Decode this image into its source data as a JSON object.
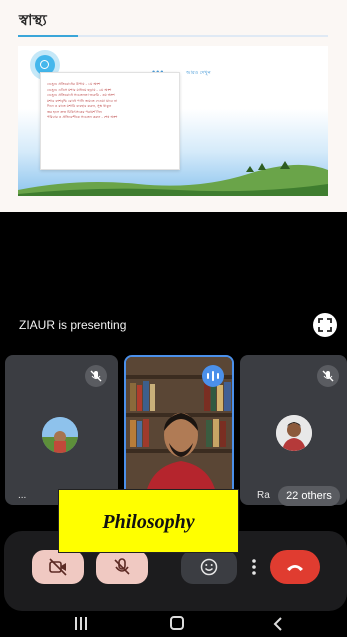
{
  "presentation": {
    "slide_title": "স্বাস্থ্য",
    "note_lines": [
      "ডেঙ্গু প্রতিরোধের উপায় - ১ম অংশ",
      "ডেঙ্গু এডিস মশার মাধ্যমে ছড়ায় - ২য় অংশ",
      "ডেঙ্গু প্রতিরোধে সচেতনতা জরুরি - ৩য় অংশ",
      "মশার বংশবৃদ্ধি রোধে পানি জমতে দেওয়া যাবে না",
      "দিনে ও রাতে মশারি ব্যবহার করুন, সুস্থ থাকুন",
      "জ্বর হলে দ্রুত চিকিৎসকের পরামর্শ নিন",
      "পরিবার ও প্রতিবেশীকে সচেতন করুন - শেষ অংশ"
    ],
    "link_text": "আরও দেখুন"
  },
  "status": {
    "presenting_text": "ZIAUR is presenting"
  },
  "participants": {
    "left_name": "...",
    "right_name": "Ra",
    "others_label": "22 others"
  },
  "caption": {
    "text": "Philosophy",
    "background": "#ffff00"
  },
  "controls": {
    "camera_icon": "camera-off-icon",
    "mic_icon": "mic-off-icon",
    "emoji_icon": "emoji-icon",
    "more_icon": "more-vert-icon",
    "hangup_icon": "end-call-icon",
    "hangup_color": "#e03c30",
    "muted_bg": "#f0c9c2"
  },
  "accent_color": "#4b90ea"
}
